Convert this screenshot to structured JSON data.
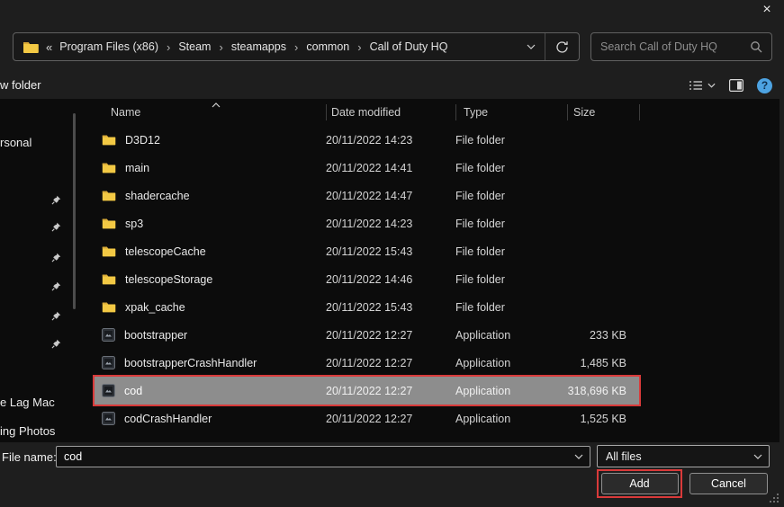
{
  "titlebar": {
    "close_glyph": "×"
  },
  "address_bar": {
    "overflow_glyph": "«",
    "separator_glyph": "›",
    "segments": [
      "Program Files (x86)",
      "Steam",
      "steamapps",
      "common",
      "Call of Duty HQ"
    ]
  },
  "search": {
    "placeholder": "Search Call of Duty HQ"
  },
  "toolbar": {
    "new_folder_label": "w folder",
    "help_glyph": "?"
  },
  "sidebar": {
    "items": [
      "rsonal",
      "e Lag Mac",
      "ing Photos"
    ],
    "pin_count": 6
  },
  "file_list": {
    "columns": [
      "Name",
      "Date modified",
      "Type",
      "Size"
    ],
    "sort": {
      "column": "Name",
      "direction": "ascending"
    },
    "rows": [
      {
        "name": "D3D12",
        "date": "20/11/2022 14:23",
        "type": "File folder",
        "size": "",
        "icon": "folder"
      },
      {
        "name": "main",
        "date": "20/11/2022 14:41",
        "type": "File folder",
        "size": "",
        "icon": "folder"
      },
      {
        "name": "shadercache",
        "date": "20/11/2022 14:47",
        "type": "File folder",
        "size": "",
        "icon": "folder"
      },
      {
        "name": "sp3",
        "date": "20/11/2022 14:23",
        "type": "File folder",
        "size": "",
        "icon": "folder"
      },
      {
        "name": "telescopeCache",
        "date": "20/11/2022 15:43",
        "type": "File folder",
        "size": "",
        "icon": "folder"
      },
      {
        "name": "telescopeStorage",
        "date": "20/11/2022 14:46",
        "type": "File folder",
        "size": "",
        "icon": "folder"
      },
      {
        "name": "xpak_cache",
        "date": "20/11/2022 15:43",
        "type": "File folder",
        "size": "",
        "icon": "folder"
      },
      {
        "name": "bootstrapper",
        "date": "20/11/2022 12:27",
        "type": "Application",
        "size": "233 KB",
        "icon": "app"
      },
      {
        "name": "bootstrapperCrashHandler",
        "date": "20/11/2022 12:27",
        "type": "Application",
        "size": "1,485 KB",
        "icon": "app"
      },
      {
        "name": "cod",
        "date": "20/11/2022 12:27",
        "type": "Application",
        "size": "318,696 KB",
        "icon": "app",
        "selected": true
      },
      {
        "name": "codCrashHandler",
        "date": "20/11/2022 12:27",
        "type": "Application",
        "size": "1,525 KB",
        "icon": "app"
      }
    ]
  },
  "footer": {
    "file_name_label": "File name:",
    "file_name_value": "cod",
    "file_type_value": "All files",
    "add_label": "Add",
    "cancel_label": "Cancel"
  },
  "colors": {
    "annotation_red": "#d93a3a",
    "selected_row": "#8d8d8d",
    "folder_yellow": "#f3c944",
    "help_blue": "#4da3e2"
  }
}
